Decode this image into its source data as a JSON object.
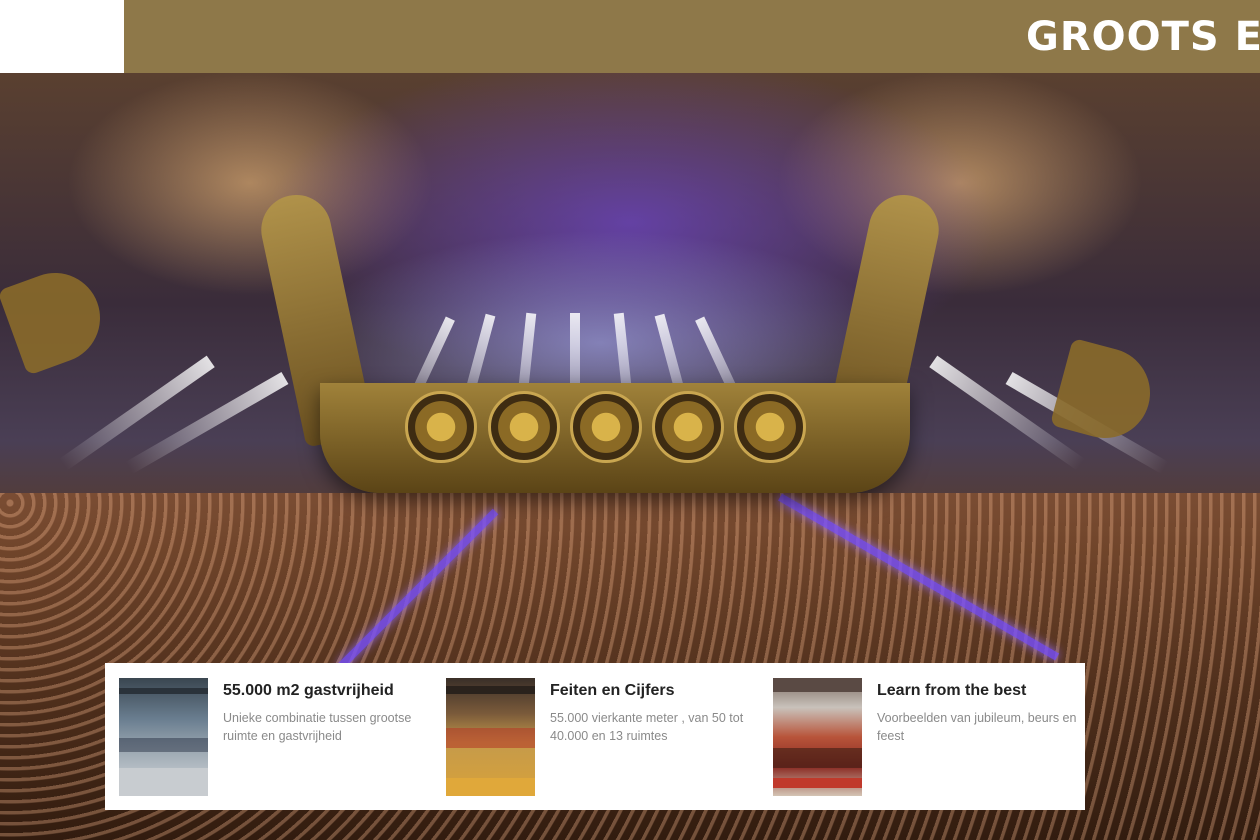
{
  "header": {
    "title": "GROOTS EN",
    "background_color": "#8e7849",
    "logo_area_color": "#ffffff"
  },
  "hero": {
    "image": "concert-hall-viking-ship-stage"
  },
  "features": [
    {
      "title": "55.000 m2 gastvrijheid",
      "description": "Unieke combinatie tussen grootse ruimte en gastvrijheid",
      "thumbnail": "exhibition-hall-photo"
    },
    {
      "title": "Feiten en Cijfers",
      "description": "55.000 vierkante meter , van 50 tot 40.000 en 13 ruimtes",
      "thumbnail": "event-hall-photo"
    },
    {
      "title": "Learn from the best",
      "description": "Voorbeelden van jubileum, beurs en feest",
      "thumbnail": "party-hall-photo"
    }
  ]
}
